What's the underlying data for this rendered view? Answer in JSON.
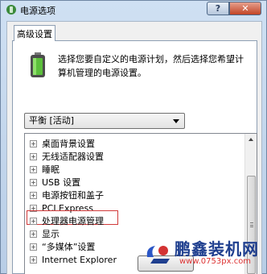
{
  "window": {
    "title": "电源选项",
    "help_label": "?",
    "close_label": "✕"
  },
  "tab": {
    "label": "高级设置"
  },
  "intro_text": "选择您要自定义的电源计划，然后选择您希望计算机管理的电源设置。",
  "plan_select": {
    "value": "平衡 [活动]"
  },
  "tree": {
    "items": [
      {
        "label": "桌面背景设置"
      },
      {
        "label": "无线适配器设置"
      },
      {
        "label": "睡眠"
      },
      {
        "label": "USB 设置"
      },
      {
        "label": "电源按钮和盖子"
      },
      {
        "label": "PCI Express"
      },
      {
        "label": "处理器电源管理"
      },
      {
        "label": "显示"
      },
      {
        "label": "“多媒体”设置"
      },
      {
        "label": "Internet Explorer"
      }
    ],
    "expander_symbol": "+"
  },
  "watermark": {
    "name": "鹏鑫装机网",
    "url": "www.0753px.com"
  },
  "colors": {
    "highlight_border": "#d13a3a",
    "watermark_name": "#1f3f8f",
    "watermark_url": "#d33333"
  }
}
